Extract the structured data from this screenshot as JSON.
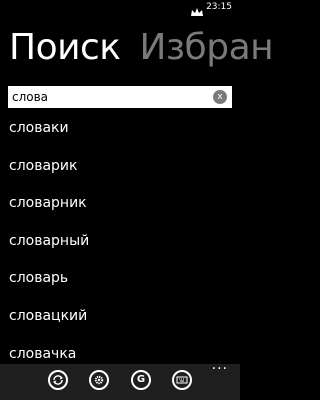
{
  "status_bar": {
    "time": "23:15",
    "tray_icon": "app-notification-icon"
  },
  "pivot": {
    "tabs": [
      {
        "label": "Поиск"
      },
      {
        "label": "Избран"
      }
    ]
  },
  "search": {
    "value": "слова",
    "clear_label": "x"
  },
  "results": [
    "словаки",
    "словарик",
    "словарник",
    "словарный",
    "словарь",
    "словацкий",
    "словачка"
  ],
  "app_bar": {
    "buttons": [
      {
        "icon": "sync-icon"
      },
      {
        "icon": "gear-icon"
      },
      {
        "icon": "google-translate-icon",
        "label": "G"
      },
      {
        "icon": "keyboard-icon"
      }
    ],
    "more_label": "···"
  }
}
